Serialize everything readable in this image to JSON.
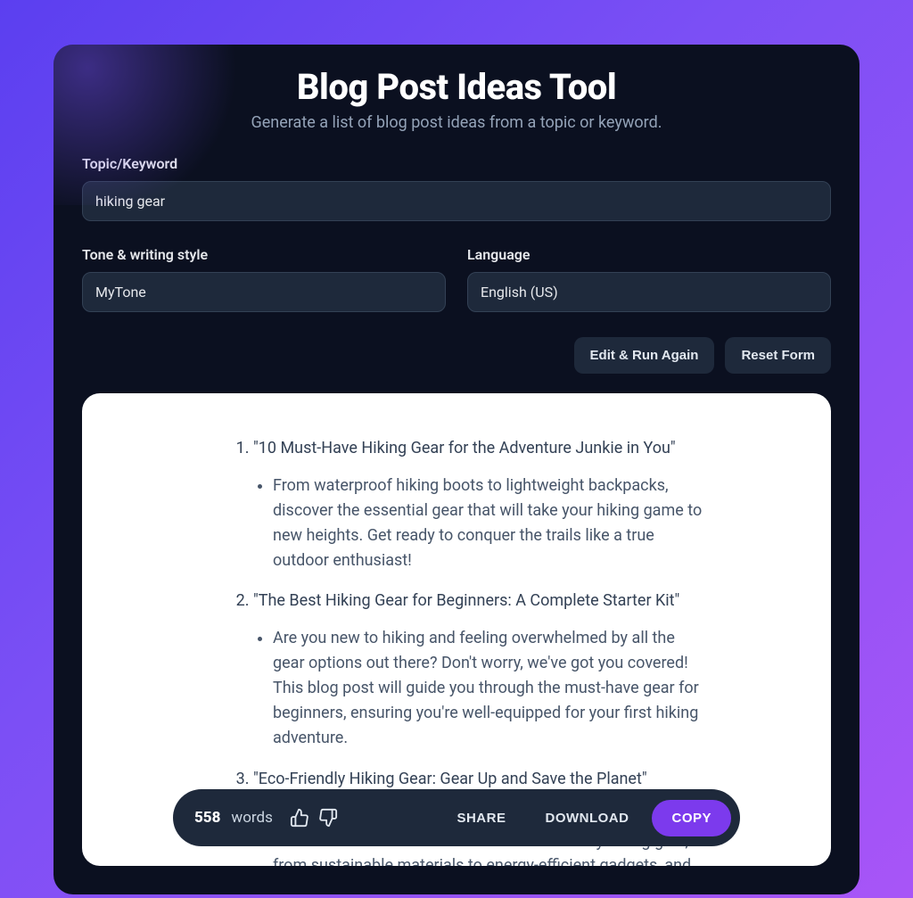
{
  "header": {
    "title": "Blog Post Ideas Tool",
    "subtitle": "Generate a list of blog post ideas from a topic or keyword."
  },
  "form": {
    "topic_label": "Topic/Keyword",
    "topic_value": "hiking gear",
    "tone_label": "Tone & writing style",
    "tone_value": "MyTone",
    "language_label": "Language",
    "language_value": "English (US)"
  },
  "buttons": {
    "edit_run": "Edit & Run Again",
    "reset": "Reset Form"
  },
  "output": {
    "ideas": [
      {
        "title": "\"10 Must-Have Hiking Gear for the Adventure Junkie in You\"",
        "desc": "From waterproof hiking boots to lightweight backpacks, discover the essential gear that will take your hiking game to new heights. Get ready to conquer the trails like a true outdoor enthusiast!"
      },
      {
        "title": "\"The Best Hiking Gear for Beginners: A Complete Starter Kit\"",
        "desc": "Are you new to hiking and feeling overwhelmed by all the gear options out there? Don't worry, we've got you covered! This blog post will guide you through the must-have gear for beginners, ensuring you're well-equipped for your first hiking adventure."
      },
      {
        "title": "\"Eco-Friendly Hiking Gear: Gear Up and Save the Planet\"",
        "desc": "Love hiking and want to minimize your impact on the environment? Check out our list of eco-friendly hiking gear, from sustainable materials to energy-efficient gadgets, and explore responsibly."
      }
    ]
  },
  "footer": {
    "word_count": "558",
    "words_label": "words",
    "share": "SHARE",
    "download": "DOWNLOAD",
    "copy": "COPY"
  }
}
